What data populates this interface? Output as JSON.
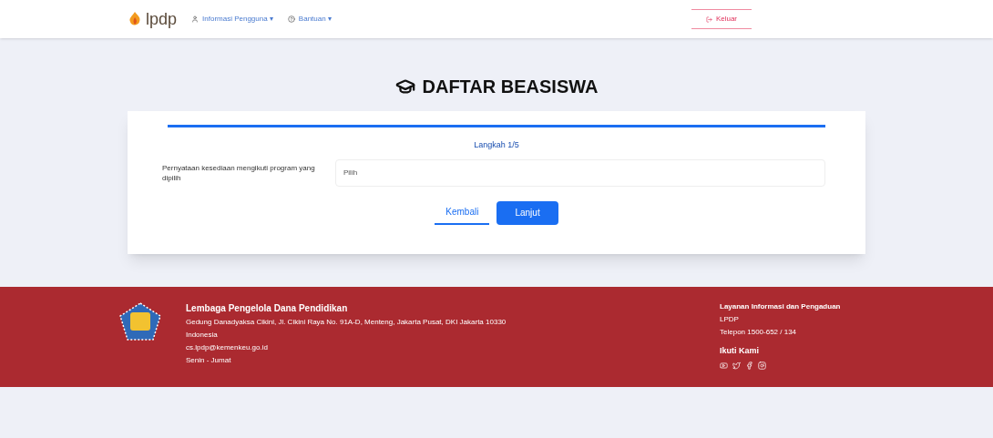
{
  "header": {
    "logo": "lpdp",
    "nav": [
      {
        "label": "Informasi Pengguna",
        "caret": "▾"
      },
      {
        "label": "Bantuan",
        "caret": "▾"
      }
    ],
    "logout": "Keluar"
  },
  "page": {
    "title": "DAFTAR BEASISWA"
  },
  "form": {
    "step": "Langkah 1/5",
    "question": "Pernyataan kesediaan mengikuti program yang dipilih",
    "select": {
      "value": "Pilih"
    },
    "buttons": [
      {
        "kind": "secondary",
        "label": "Kembali"
      },
      {
        "kind": "primary",
        "label": "Lanjut"
      }
    ]
  },
  "footer": {
    "org": "Lembaga Pengelola Dana Pendidikan",
    "address": "Gedung Danadyaksa Cikini, Jl. Cikini Raya No. 91A-D, Menteng, Jakarta Pusat, DKI Jakarta 10330",
    "lines": [
      "Indonesia",
      "cs.lpdp@kemenkeu.go.id",
      "Senin - Jumat"
    ],
    "contact_title": "Layanan Informasi dan Pengaduan",
    "contact_lines": [
      "LPDP",
      "Telepon 1500-652 / 134"
    ],
    "follow_title": "Ikuti Kami"
  }
}
